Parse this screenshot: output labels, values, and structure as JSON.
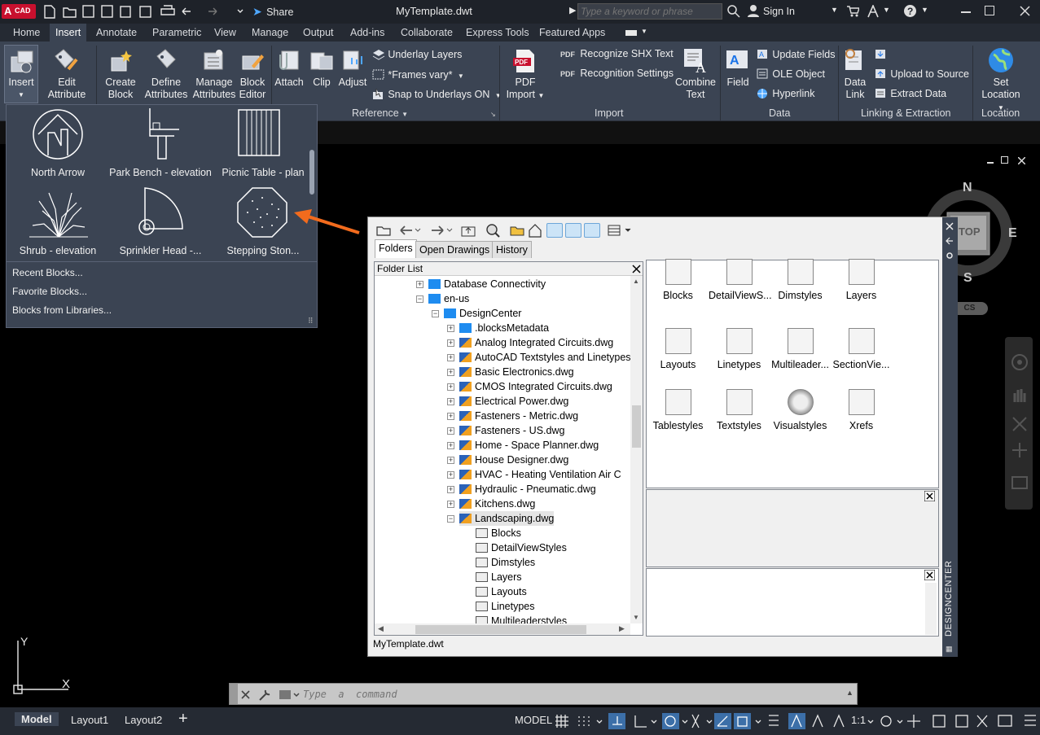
{
  "titlebar": {
    "app_badge": "CAD",
    "document_title": "MyTemplate.dwt",
    "share_label": "Share",
    "search_placeholder": "Type a keyword or phrase",
    "sign_in_label": "Sign In"
  },
  "ribbon_tabs": [
    "Home",
    "Insert",
    "Annotate",
    "Parametric",
    "View",
    "Manage",
    "Output",
    "Add-ins",
    "Collaborate",
    "Express Tools",
    "Featured Apps"
  ],
  "ribbon": {
    "insert_label": "Insert",
    "edit_attribute": [
      "Edit",
      "Attribute"
    ],
    "create_block": [
      "Create",
      "Block"
    ],
    "define_attributes": [
      "Define",
      "Attributes"
    ],
    "manage_attributes": [
      "Manage",
      "Attributes"
    ],
    "block_editor": [
      "Block",
      "Editor"
    ],
    "attach": "Attach",
    "clip": "Clip",
    "adjust": "Adjust",
    "underlay_layers": "Underlay Layers",
    "frames_vary": "*Frames vary*",
    "snap_to_underlays": "Snap to Underlays ON",
    "reference_panel": "Reference",
    "pdf_import": [
      "PDF",
      "Import"
    ],
    "recognize_shx": "Recognize SHX Text",
    "recognition_settings": "Recognition Settings",
    "combine_text": [
      "Combine",
      "Text"
    ],
    "import_panel": "Import",
    "field": "Field",
    "update_fields": "Update Fields",
    "ole_object": "OLE Object",
    "hyperlink": "Hyperlink",
    "data_panel": "Data",
    "data_link": [
      "Data",
      "Link"
    ],
    "upload_to_source": "Upload to Source",
    "extract_data": "Extract  Data",
    "linking_panel": "Linking & Extraction",
    "set_location": [
      "Set",
      "Location"
    ],
    "location_panel": "Location"
  },
  "block_gallery": {
    "items": [
      "North Arrow",
      "Park Bench - elevation",
      "Picnic Table - plan",
      "Shrub - elevation",
      "Sprinkler Head -...",
      "Stepping Ston..."
    ],
    "links": [
      "Recent Blocks...",
      "Favorite Blocks...",
      "Blocks from Libraries..."
    ]
  },
  "viewcube": {
    "top": "TOP",
    "n": "N",
    "e": "E",
    "s": "S",
    "ucs": "CS"
  },
  "designcenter": {
    "tabs": [
      "Folders",
      "Open Drawings",
      "History"
    ],
    "folder_list_label": "Folder List",
    "tree": [
      "Database Connectivity",
      "en-us",
      "DesignCenter",
      ".blocksMetadata",
      "Analog Integrated Circuits.dwg",
      "AutoCAD Textstyles and Linetypes",
      "Basic Electronics.dwg",
      "CMOS Integrated Circuits.dwg",
      "Electrical Power.dwg",
      "Fasteners - Metric.dwg",
      "Fasteners - US.dwg",
      "Home - Space Planner.dwg",
      "House Designer.dwg",
      "HVAC - Heating Ventilation Air C",
      "Hydraulic - Pneumatic.dwg",
      "Kitchens.dwg",
      "Landscaping.dwg",
      "Blocks",
      "DetailViewStyles",
      "Dimstyles",
      "Layers",
      "Layouts",
      "Linetypes",
      "Multileaderstyles"
    ],
    "content_items": [
      "Blocks",
      "DetailViewS...",
      "Dimstyles",
      "Layers",
      "Layouts",
      "Linetypes",
      "Multileader...",
      "SectionVie...",
      "Tablestyles",
      "Textstyles",
      "Visualstyles",
      "Xrefs"
    ],
    "status": "MyTemplate.dwt",
    "side_title": "DESIGNCENTER"
  },
  "command": {
    "placeholder": "Type  a  command"
  },
  "axes": {
    "y": "Y",
    "x": "X"
  },
  "status_bar": {
    "tabs": [
      "Model",
      "Layout1",
      "Layout2"
    ],
    "model_label": "MODEL",
    "scale": "1:1"
  },
  "colors": {
    "accent_red": "#c8102e",
    "ribbon": "#3b4453",
    "arrow": "#f26b1d"
  }
}
